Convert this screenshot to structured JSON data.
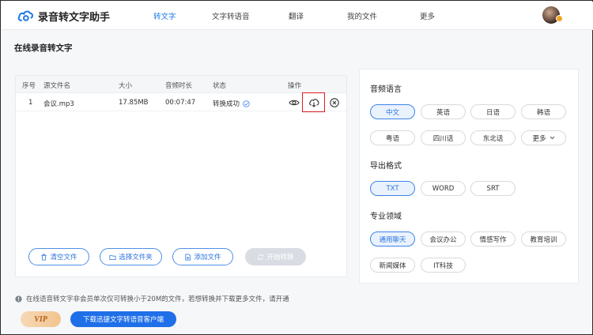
{
  "app": {
    "name": "录音转文字助手"
  },
  "nav": {
    "items": [
      {
        "label": "转文字",
        "active": true
      },
      {
        "label": "文字转语音",
        "active": false
      },
      {
        "label": "翻译",
        "active": false
      },
      {
        "label": "我的文件",
        "active": false
      },
      {
        "label": "更多",
        "active": false
      }
    ]
  },
  "page": {
    "title": "在线录音转文字"
  },
  "table": {
    "headers": [
      "序号",
      "源文件名",
      "大小",
      "音频时长",
      "状态",
      "操作"
    ],
    "rows": [
      {
        "index": "1",
        "filename": "会议.mp3",
        "size": "17.85MB",
        "duration": "00:07:47",
        "status": "转换成功"
      }
    ]
  },
  "actions": {
    "clear": "清空文件",
    "select_folder": "选择文件夹",
    "add_file": "添加文件",
    "start": "开始转换"
  },
  "settings": {
    "language_title": "音频语言",
    "languages": [
      "中文",
      "英语",
      "日语",
      "韩语",
      "粤语",
      "四川话",
      "东北话",
      "更多"
    ],
    "selected_language": "中文",
    "format_title": "导出格式",
    "formats": [
      "TXT",
      "WORD",
      "SRT"
    ],
    "selected_format": "TXT",
    "domain_title": "专业领域",
    "domains": [
      "通用聊天",
      "会议办公",
      "情感写作",
      "教育培训",
      "新闻媒体",
      "IT科技"
    ],
    "selected_domain": "通用聊天"
  },
  "footer": {
    "notice": "在线语音转文字非会员单次仅可转换小于20M的文件，若想转换并下载更多文件，请开通",
    "vip_label": "VIP",
    "download_label": "下载迅捷文字转语音客户端"
  },
  "colors": {
    "accent": "#1f7ae8",
    "highlight": "#e31b23",
    "success": "#3b83ea"
  }
}
